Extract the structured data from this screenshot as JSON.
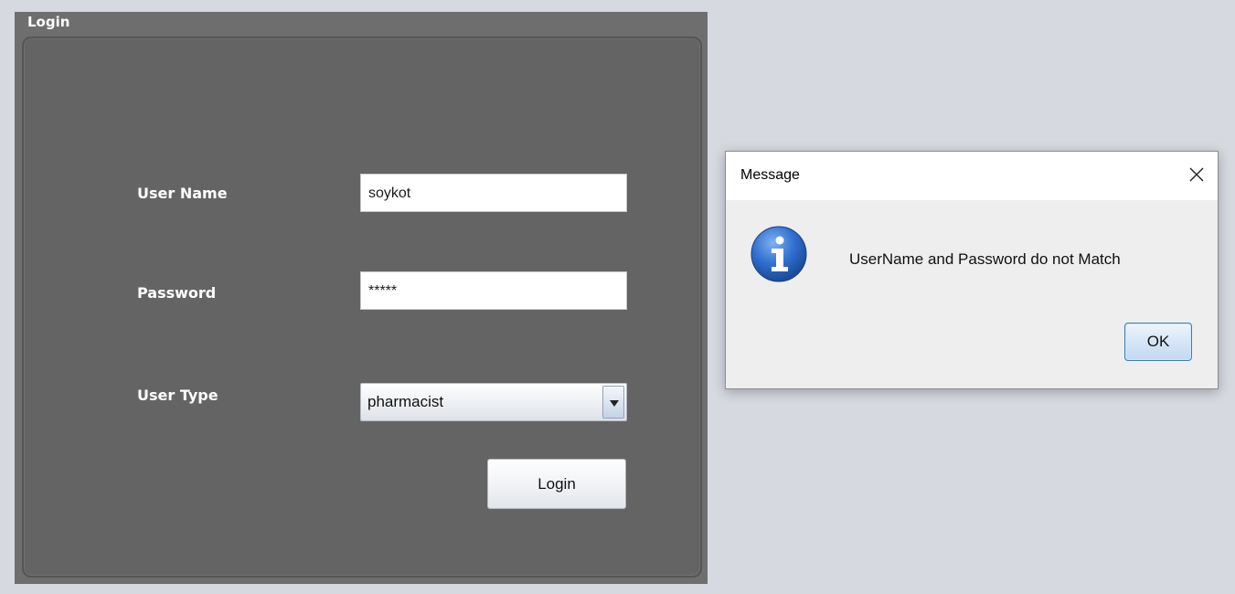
{
  "login_frame": {
    "title": "Login",
    "fields": {
      "username_label": "User Name",
      "username_value": "soykot",
      "password_label": "Password",
      "password_value": "*****",
      "usertype_label": "User Type",
      "usertype_value": "pharmacist"
    },
    "login_button": "Login"
  },
  "dialog": {
    "title": "Message",
    "message": "UserName and Password do not Match",
    "ok_button": "OK",
    "icon": "info-icon"
  },
  "colors": {
    "frame_bg": "#6e6e6e",
    "panel_bg": "#646464",
    "desktop_bg": "#d6d9e0",
    "dialog_bg": "#eeeeee",
    "info_blue": "#2f6fcf"
  }
}
